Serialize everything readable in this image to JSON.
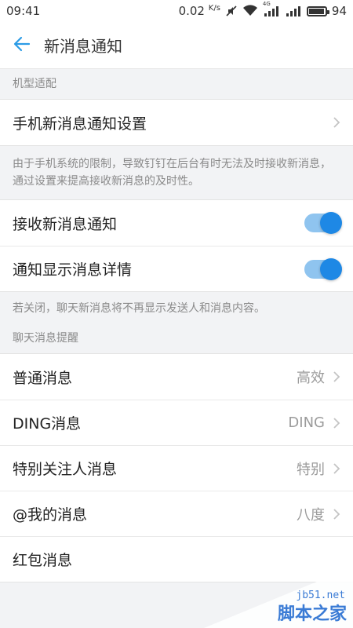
{
  "status_bar": {
    "time": "09:41",
    "speed": "0.02",
    "speed_unit": "K/s",
    "network_tag": "4G",
    "battery_level": "94",
    "battery_fraction": 0.94
  },
  "nav": {
    "title": "新消息通知",
    "back_icon": "back-arrow-icon",
    "accent_color": "#2b9be6"
  },
  "sections": {
    "model_adapt": {
      "header": "机型适配",
      "phone_setting_label": "手机新消息通知设置",
      "note": "由于手机系统的限制，导致钉钉在后台有时无法及时接收新消息，通过设置来提高接收新消息的及时性。"
    },
    "notifications": {
      "receive_label": "接收新消息通知",
      "receive_on": true,
      "details_label": "通知显示消息详情",
      "details_on": true,
      "note": "若关闭，聊天新消息将不再显示发送人和消息内容。"
    },
    "chat_reminder": {
      "header": "聊天消息提醒",
      "items": [
        {
          "label": "普通消息",
          "value": "高效"
        },
        {
          "label": "DING消息",
          "value": "DING"
        },
        {
          "label": "特别关注人消息",
          "value": "特别"
        },
        {
          "label": "@我的消息",
          "value": "八度"
        },
        {
          "label": "红包消息",
          "value": ""
        }
      ]
    }
  },
  "colors": {
    "toggle_track": "#8fc4ef",
    "toggle_knob": "#1e88e5"
  },
  "watermark": {
    "domain": "jb51.net",
    "name": "脚本之家"
  }
}
